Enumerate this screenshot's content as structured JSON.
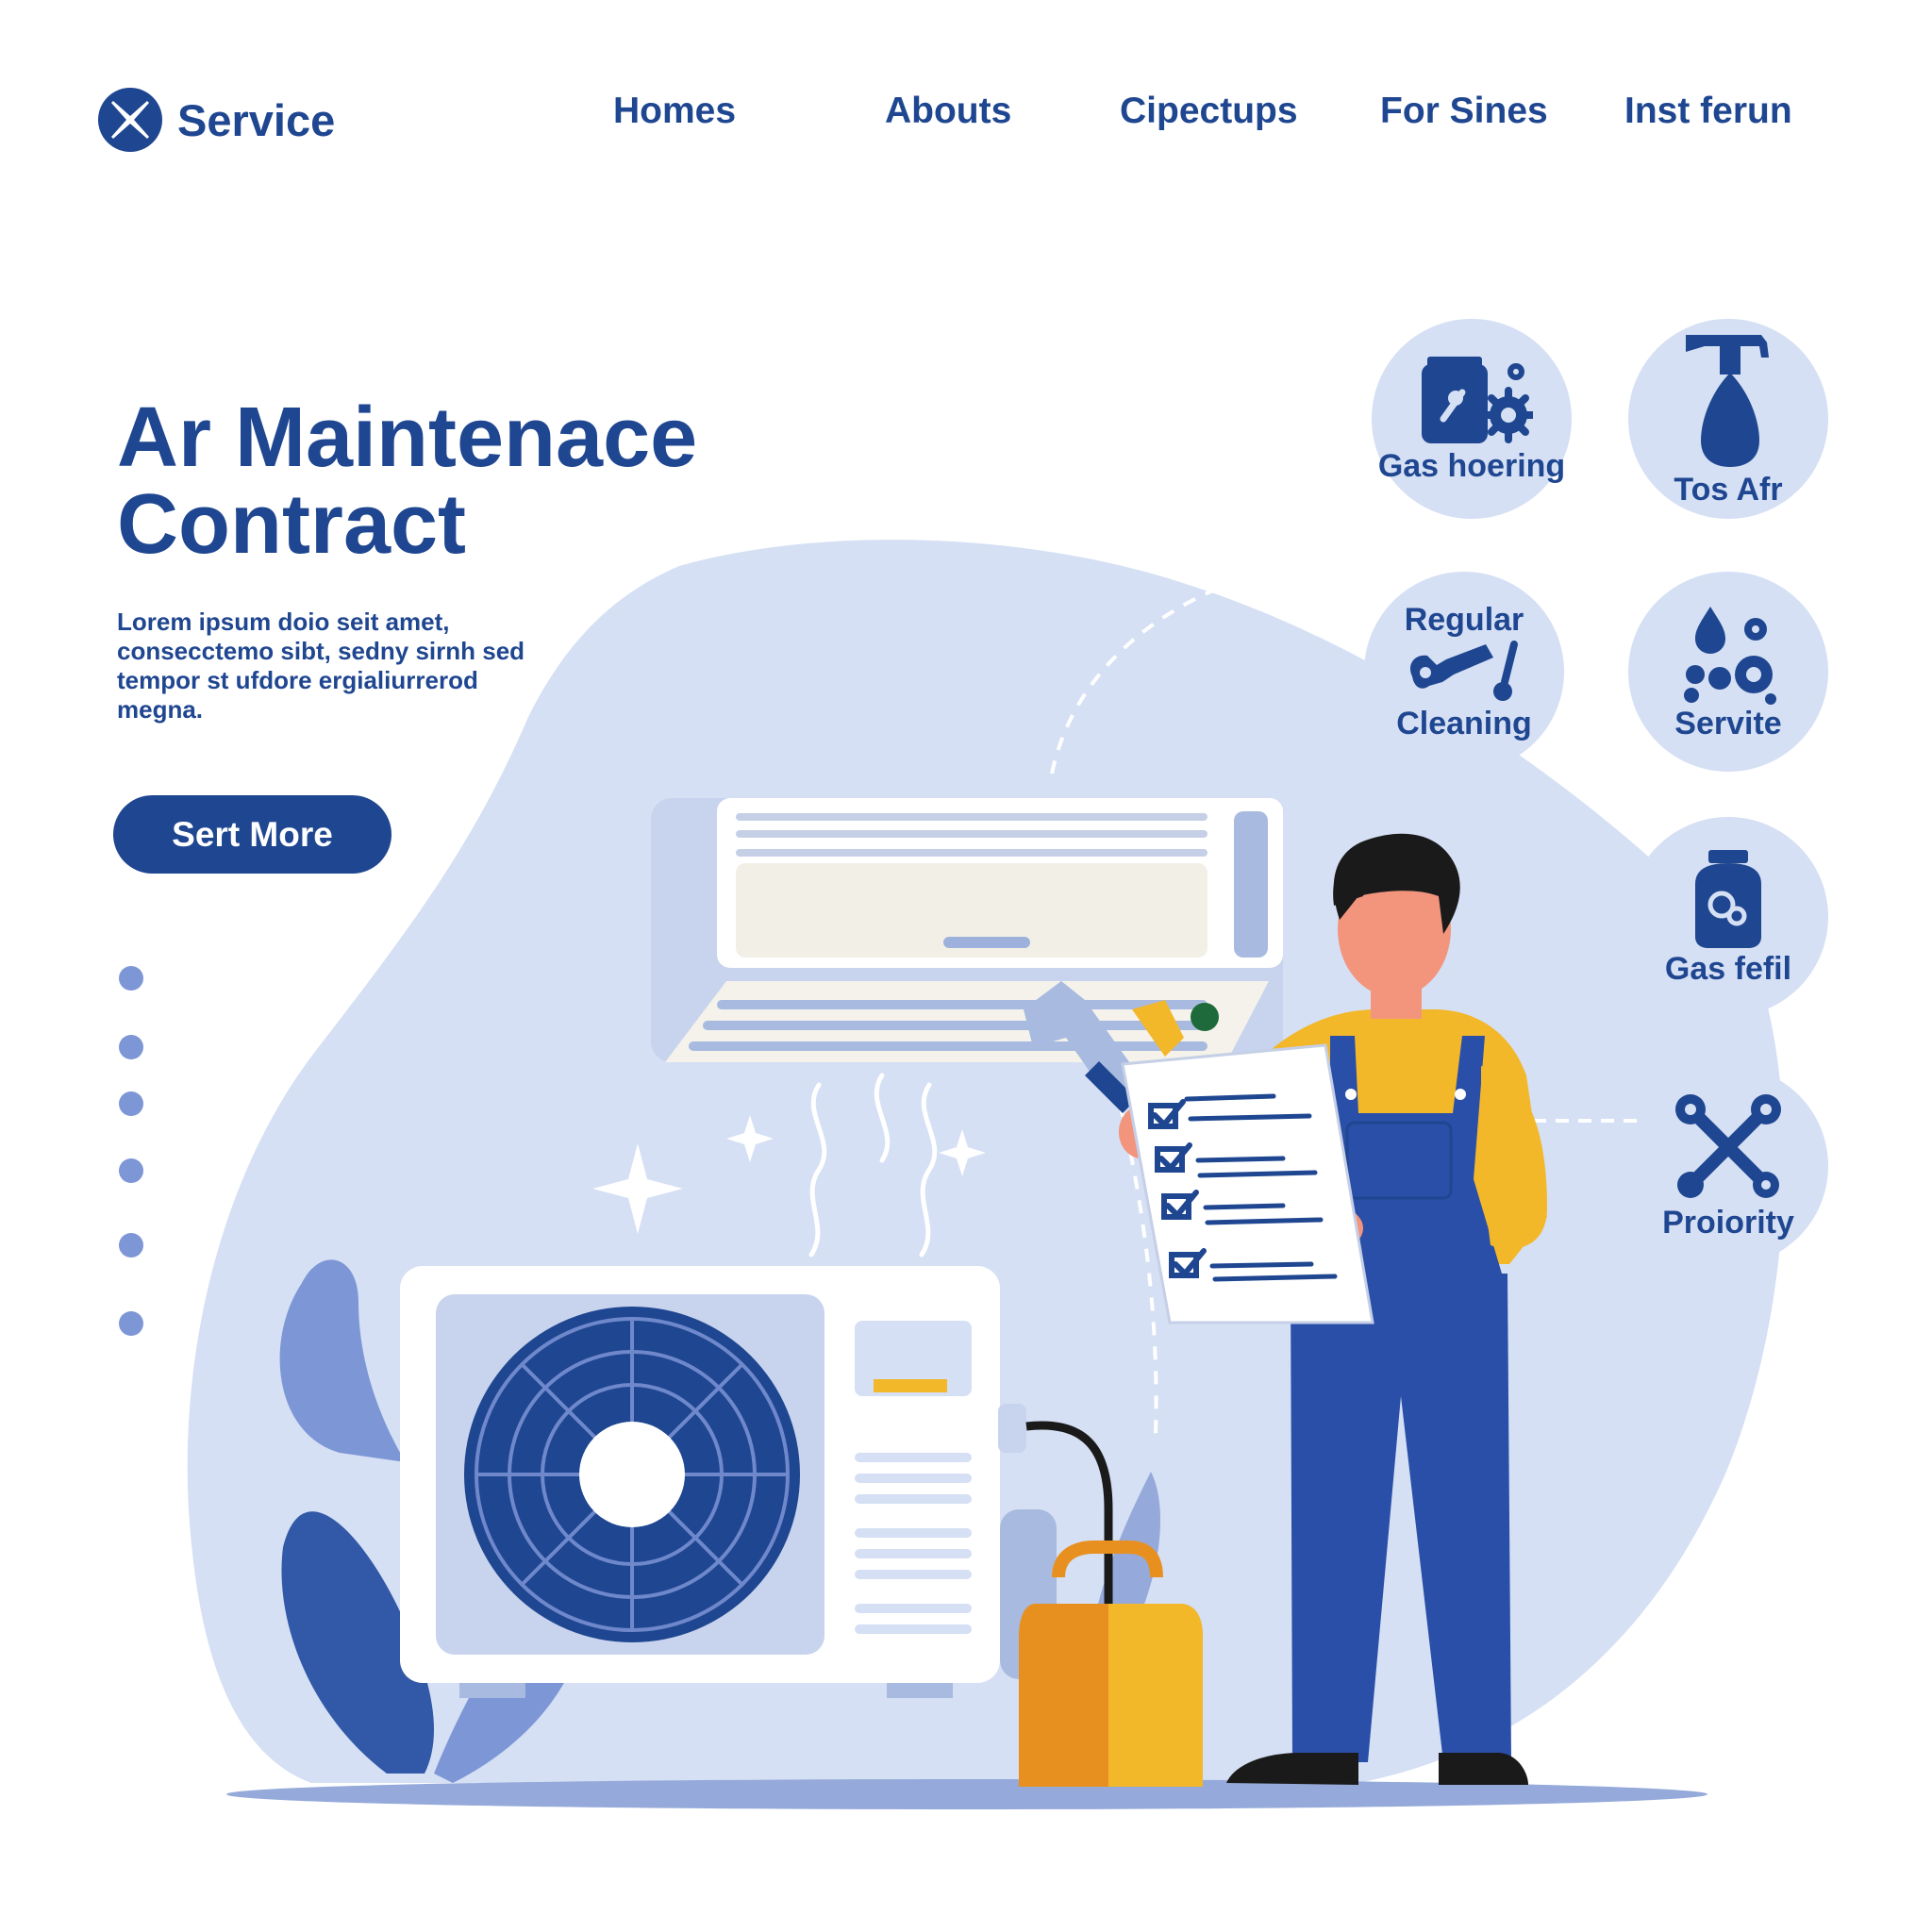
{
  "header": {
    "logo_text": "Service",
    "nav": [
      "Homes",
      "Abouts",
      "Cipectups",
      "For Sines",
      "Inst ferun"
    ]
  },
  "hero": {
    "title_line1": "Ar Maintenace",
    "title_line2": "Contract",
    "description": "Lorem ipsum doio seit amet, consecctemo sibt, sedny sirnh sed tempor st ufdore ergialiurrerod megna.",
    "cta_label": "Sert More"
  },
  "pagination": {
    "count": 6
  },
  "services": [
    {
      "label": "Gas hoering",
      "icon": "gas-jar-gear-icon"
    },
    {
      "label": "Tos Afr",
      "icon": "spray-bottle-icon"
    },
    {
      "label_top": "Regular",
      "label_bottom": "Cleaning",
      "icon": "wrench-cleaning-icon"
    },
    {
      "label": "Servite",
      "icon": "droplets-gears-icon"
    },
    {
      "label": "Gas fefil",
      "icon": "gas-cylinder-icon"
    },
    {
      "label": "Proiority",
      "icon": "crossed-tools-icon"
    }
  ],
  "colors": {
    "brand": "#1f4690",
    "blob": "#d5e0f4",
    "accent_yellow": "#f3b72a",
    "accent_orange": "#e8901f",
    "dot": "#7d96d6"
  }
}
